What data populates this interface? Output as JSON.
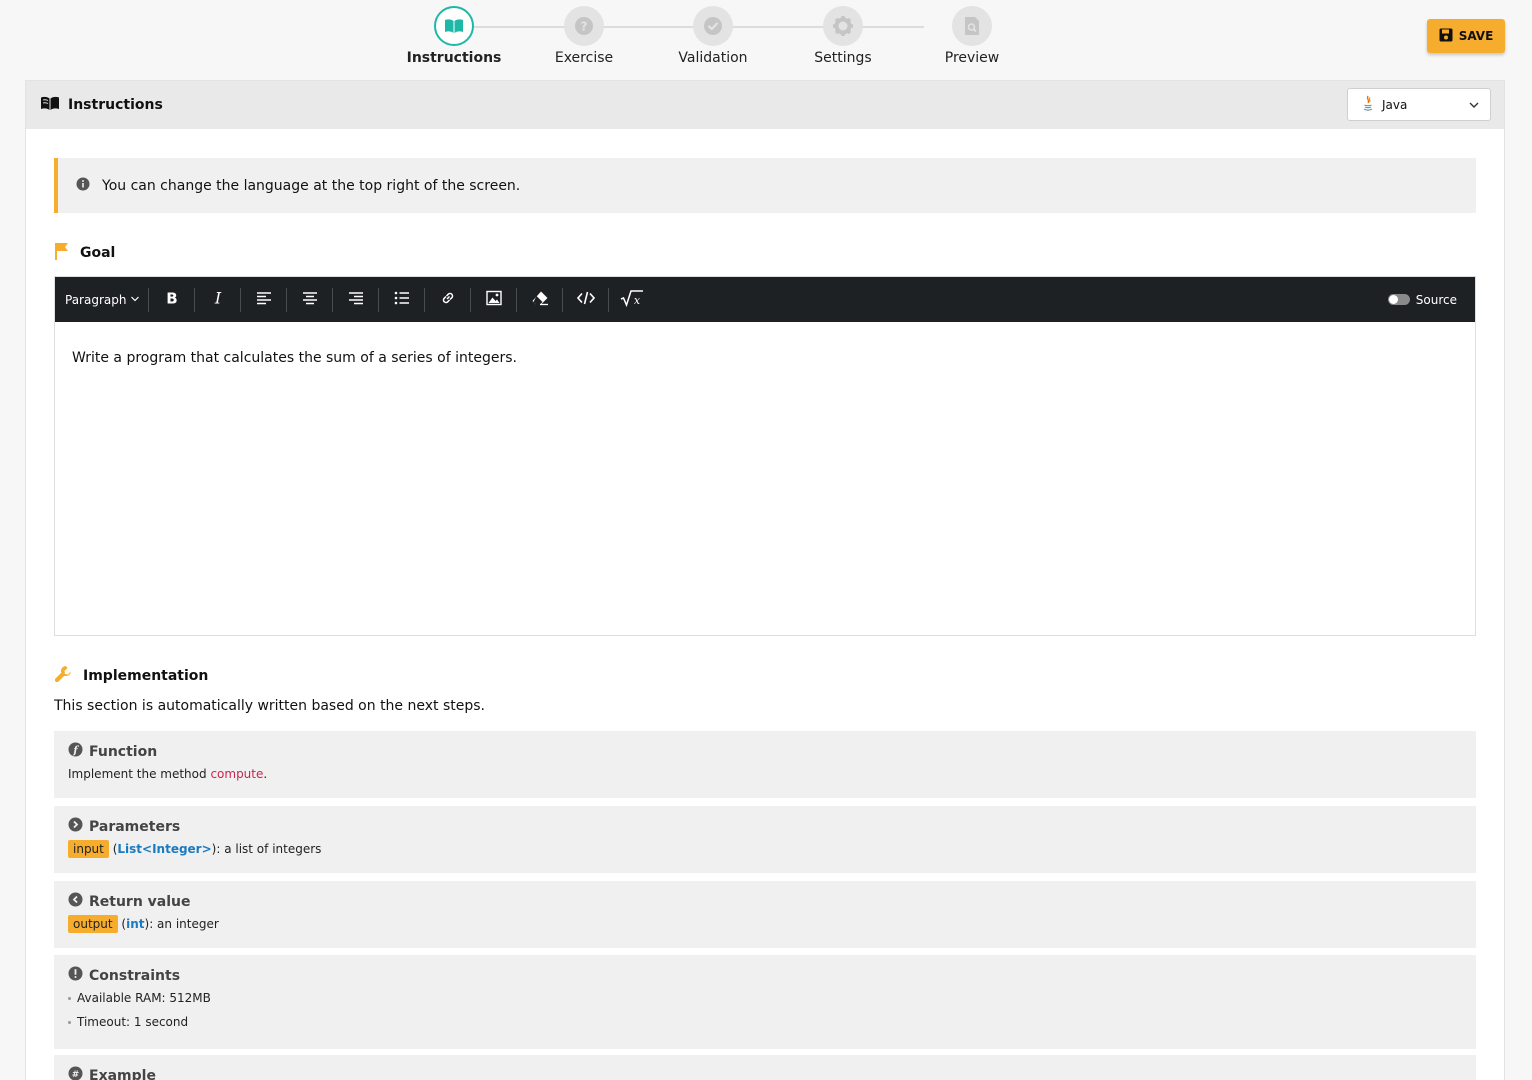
{
  "stepper": {
    "steps": [
      {
        "label": "Instructions"
      },
      {
        "label": "Exercise"
      },
      {
        "label": "Validation"
      },
      {
        "label": "Settings"
      },
      {
        "label": "Preview"
      }
    ],
    "active_index": 0
  },
  "toolbar": {
    "save_label": "SAVE"
  },
  "panel": {
    "title": "Instructions",
    "language": "Java"
  },
  "info": {
    "text": "You can change the language at the top right of the screen."
  },
  "goal": {
    "title": "Goal",
    "editor": {
      "paragraph_label": "Paragraph",
      "source_label": "Source",
      "content": "Write a program that calculates the sum of a series of integers."
    }
  },
  "implementation": {
    "title": "Implementation",
    "description": "This section is automatically written based on the next steps.",
    "function": {
      "title": "Function",
      "prefix": "Implement the method ",
      "method": "compute",
      "suffix": "."
    },
    "parameters": {
      "title": "Parameters",
      "name": "input",
      "type": "List<Integer>",
      "description": ": a list of integers"
    },
    "return_value": {
      "title": "Return value",
      "name": "output",
      "type": "int",
      "description": ": an integer"
    },
    "constraints": {
      "title": "Constraints",
      "items": [
        "Available RAM: 512MB",
        "Timeout: 1 second"
      ]
    },
    "example": {
      "title": "Example"
    }
  },
  "colors": {
    "accent": "#f6ad2e",
    "active_step": "#1fb8a6",
    "keyword": "#c7254e",
    "type": "#1a7bc0"
  }
}
